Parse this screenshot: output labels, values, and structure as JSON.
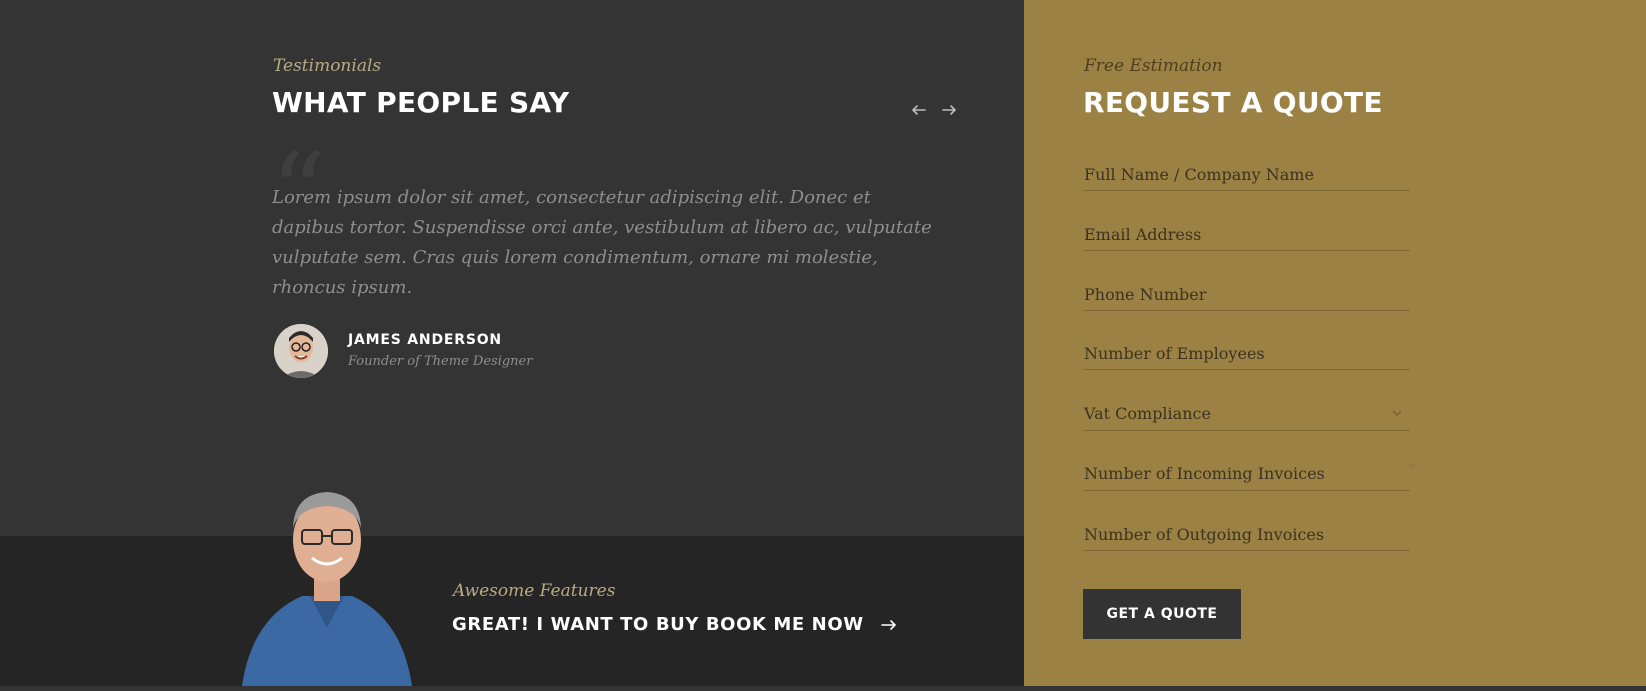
{
  "testimonials": {
    "eyebrow": "Testimonials",
    "heading": "WHAT PEOPLE SAY",
    "quote": "Lorem ipsum dolor sit amet, consectetur adipiscing elit. Donec et dapibus tortor. Suspendisse orci ante, vestibulum at libero ac, vulputate vulputate sem. Cras quis lorem condimentum, ornare mi molestie, rhoncus ipsum.",
    "author": {
      "name": "JAMES ANDERSON",
      "role": "Founder of Theme Designer"
    },
    "nav": {
      "prev_icon": "arrow-left-icon",
      "next_icon": "arrow-right-icon"
    }
  },
  "features": {
    "eyebrow": "Awesome Features",
    "cta": "GREAT! I WANT TO BUY BOOK ME NOW",
    "cta_icon": "arrow-right-icon"
  },
  "quote_form": {
    "eyebrow": "Free Estimation",
    "heading": "REQUEST A QUOTE",
    "fields": {
      "full_name": "Full Name / Company Name",
      "email": "Email Address",
      "phone": "Phone Number",
      "employees": "Number of Employees",
      "vat": "Vat Compliance",
      "incoming": "Number of Incoming Invoices",
      "outgoing": "Number of Outgoing Invoices"
    },
    "submit": "GET A QUOTE"
  },
  "colors": {
    "dark_bg": "#343434",
    "darker_bg": "#252525",
    "gold": "#9b8244",
    "button": "#333333"
  }
}
